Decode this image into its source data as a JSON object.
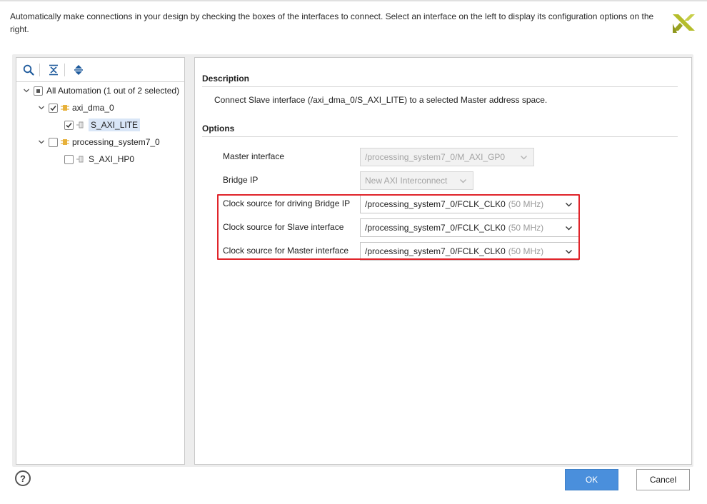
{
  "header": {
    "instructions": "Automatically make connections in your design by checking the boxes of the interfaces to connect. Select an interface on the left to display its configuration options on the right."
  },
  "toolbar": {
    "icons": [
      "search-icon",
      "collapse-all-icon",
      "expand-all-icon"
    ]
  },
  "tree": {
    "root": {
      "label": "All Automation (1 out of 2 selected)",
      "state": "partial"
    },
    "nodes": [
      {
        "label": "axi_dma_0",
        "checked": true,
        "expanded": true,
        "children": [
          {
            "label": "S_AXI_LITE",
            "checked": true,
            "selected": true
          }
        ]
      },
      {
        "label": "processing_system7_0",
        "checked": false,
        "expanded": true,
        "children": [
          {
            "label": "S_AXI_HP0",
            "checked": false,
            "selected": false
          }
        ]
      }
    ]
  },
  "description": {
    "title": "Description",
    "text": "Connect Slave interface (/axi_dma_0/S_AXI_LITE) to a selected Master address space."
  },
  "options": {
    "title": "Options",
    "items": [
      {
        "label": "Master interface",
        "value": "/processing_system7_0/M_AXI_GP0",
        "note": "",
        "enabled": false
      },
      {
        "label": "Bridge IP",
        "value": "New AXI Interconnect",
        "note": "",
        "enabled": false
      },
      {
        "label": "Clock source for driving Bridge IP",
        "value": "/processing_system7_0/FCLK_CLK0",
        "note": "(50 MHz)",
        "enabled": true
      },
      {
        "label": "Clock source for Slave interface",
        "value": "/processing_system7_0/FCLK_CLK0",
        "note": "(50 MHz)",
        "enabled": true
      },
      {
        "label": "Clock source for Master interface",
        "value": "/processing_system7_0/FCLK_CLK0",
        "note": "(50 MHz)",
        "enabled": true
      }
    ]
  },
  "footer": {
    "help": "?",
    "ok": "OK",
    "cancel": "Cancel"
  },
  "colors": {
    "accent": "#4a8fdc",
    "highlight": "#e0242a",
    "selection": "#d9e6f7",
    "logo": "#b5bd2b"
  }
}
